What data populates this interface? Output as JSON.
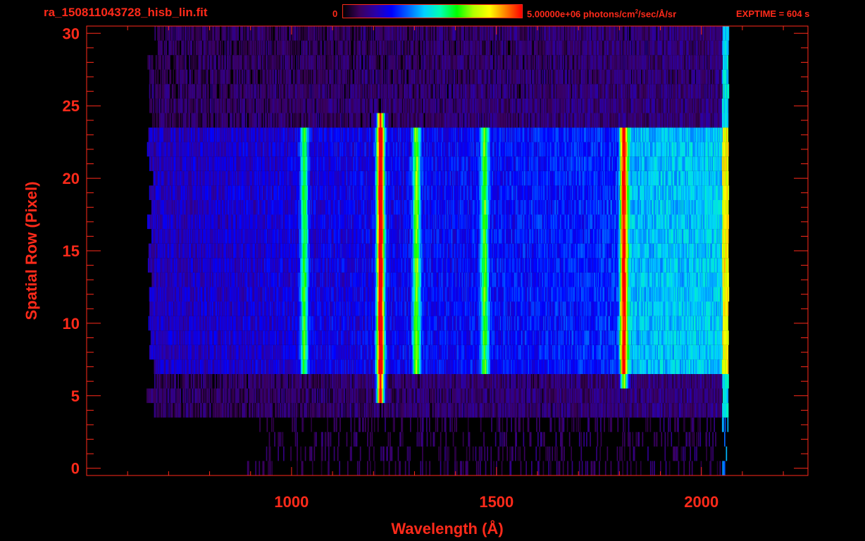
{
  "header": {
    "filename": "ra_150811043728_hisb_lin.fit",
    "colorbar_min": "0",
    "colorbar_max": "5.00000e+06 photons/cm",
    "colorbar_max_sup": "2",
    "colorbar_max_tail": "/sec/Å/sr",
    "exptime": "EXPTIME = 604 s"
  },
  "colors": {
    "axis": "#ff2a1a",
    "background": "#000000",
    "colormap": [
      "#000000",
      "#3a005a",
      "#2a00a8",
      "#0000ff",
      "#0064ff",
      "#00d0ff",
      "#00ffb0",
      "#00ff00",
      "#b0ff00",
      "#ffff00",
      "#ff8000",
      "#ff0000"
    ]
  },
  "chart_data": {
    "type": "heatmap",
    "title": "",
    "xlabel": "Wavelength (Å)",
    "ylabel": "Spatial Row (Pixel)",
    "xlim": [
      500,
      2260
    ],
    "ylim": [
      -0.5,
      30.5
    ],
    "xticks": [
      1000,
      1500,
      2000
    ],
    "xtick_labels": [
      "1000",
      "1500",
      "2000"
    ],
    "yticks": [
      0,
      5,
      10,
      15,
      20,
      25,
      30
    ],
    "ytick_labels": [
      "0",
      "5",
      "10",
      "15",
      "20",
      "25",
      "30"
    ],
    "x_minor_step": 100,
    "y_minor_step": 1,
    "grid": false,
    "colorbar": {
      "min": 0,
      "max": 5000000,
      "units": "photons/cm^2/sec/Å/sr"
    },
    "data_wavelength_range": [
      665,
      2065
    ],
    "slit_rows": [
      7,
      23
    ],
    "emission_lines": [
      {
        "wavelength": 1216,
        "intensity_fraction": 0.9,
        "rows": [
          5,
          24
        ]
      },
      {
        "wavelength": 1304,
        "intensity_fraction": 0.45,
        "rows": [
          7,
          23
        ]
      },
      {
        "wavelength": 1030,
        "intensity_fraction": 0.4,
        "rows": [
          7,
          23
        ]
      },
      {
        "wavelength": 1470,
        "intensity_fraction": 0.4,
        "rows": [
          7,
          23
        ]
      },
      {
        "wavelength": 1810,
        "intensity_fraction": 0.6,
        "rows": [
          6,
          23
        ]
      }
    ]
  }
}
